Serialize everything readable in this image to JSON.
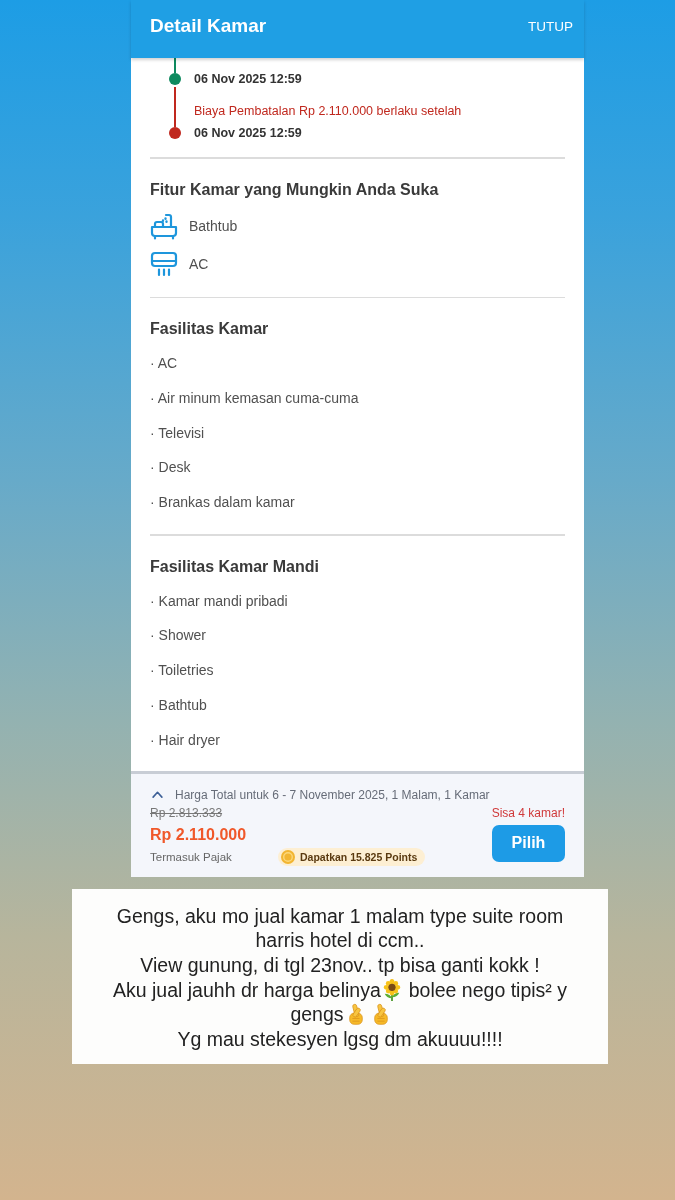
{
  "header": {
    "title": "Detail Kamar",
    "close_label": "TUTUP"
  },
  "cancellation_timeline": [
    {
      "color": "#0e8a5f",
      "date": "06 Nov 2025 12:59"
    },
    {
      "color": "#c0281e",
      "label": "Biaya Pembatalan Rp 2.110.000 berlaku setelah",
      "date": "06 Nov 2025 12:59"
    }
  ],
  "room_features": {
    "title": "Fitur Kamar yang Mungkin Anda Suka",
    "items": [
      {
        "kind": "bathtub",
        "label": "Bathtub"
      },
      {
        "kind": "aircon",
        "label": "AC"
      }
    ]
  },
  "room_facilities": {
    "title": "Fasilitas Kamar",
    "items": [
      "· AC",
      "· Air minum kemasan cuma-cuma",
      "· Televisi",
      "· Desk",
      "· Brankas dalam kamar"
    ]
  },
  "bathroom_facilities": {
    "title": "Fasilitas Kamar Mandi",
    "items": [
      "· Kamar mandi pribadi",
      "· Shower",
      "· Toiletries",
      "· Bathtub",
      "· Hair dryer"
    ]
  },
  "price_bar": {
    "summary": "Harga Total untuk 6 - 7 November 2025, 1 Malam, 1 Kamar",
    "original_price": "Rp 2.813.333",
    "price": "Rp 2.110.000",
    "tax_note": "Termasuk Pajak",
    "points": "Dapatkan 15.825 Points",
    "availability": "Sisa 4 kamar!",
    "button": "Pilih"
  },
  "caption": {
    "lines": [
      [
        {
          "kind": "text",
          "text": "Gengs, aku mo jual kamar 1 malam type suite room"
        }
      ],
      [
        {
          "kind": "text",
          "text": "harris hotel di ccm.."
        }
      ],
      [
        {
          "kind": "text",
          "text": "View gunung, di tgl 23nov.. tp bisa ganti kokk !"
        }
      ],
      [
        {
          "kind": "text",
          "text": "Aku jual jauhh dr harga belinya"
        },
        {
          "kind": "sunflower"
        },
        {
          "kind": "text",
          "text": "bolee nego tipis² y"
        }
      ],
      [
        {
          "kind": "text",
          "text": "gengs"
        },
        {
          "kind": "finger_heart"
        },
        {
          "kind": "finger_heart"
        }
      ],
      [
        {
          "kind": "text",
          "text": "Yg mau stekesyen lgsg dm akuuuu!!!!"
        }
      ]
    ]
  }
}
